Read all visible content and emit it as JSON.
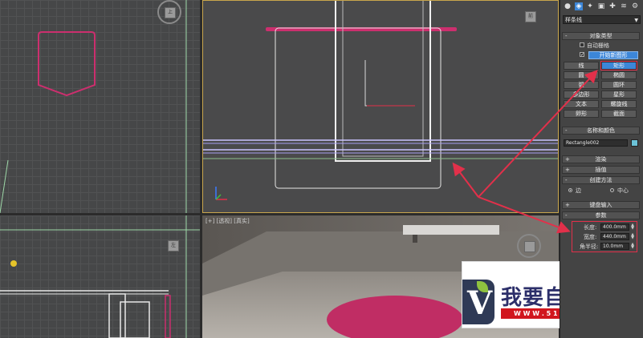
{
  "panel": {
    "dropdown_value": "样条线",
    "object_type": {
      "title": "对象类型",
      "autogrid_label": "自动栅格",
      "start_new_shape_label": "开始新图形",
      "buttons": [
        "线",
        "矩形",
        "圆",
        "椭圆",
        "弧",
        "圆环",
        "多边形",
        "星形",
        "文本",
        "螺旋线",
        "卵形",
        "截面"
      ]
    },
    "name_color": {
      "title": "名称和颜色",
      "name_value": "Rectangle002",
      "swatch_color": "#6cc3d8"
    },
    "render_title": "渲染",
    "interp_title": "插值",
    "creation_method": {
      "title": "创建方法",
      "option_edge": "边",
      "option_center": "中心"
    },
    "keyboard_title": "键盘输入",
    "params": {
      "title": "参数",
      "length_label": "长度:",
      "length_value": "400.0mm",
      "width_label": "宽度:",
      "width_value": "440.0mm",
      "corner_label": "角半径:",
      "corner_value": "10.0mm"
    }
  },
  "viewports": {
    "bottom_right_label": "[+] [透视] [真实]"
  },
  "watermark": {
    "logo_letter": "V",
    "title": "我要自學網",
    "url": "W W W . 5 1 z x w . N E T"
  },
  "colors": {
    "highlight_red": "#e2304a",
    "selection_blue": "#3c86d8",
    "shape_pink": "#cc2f6e"
  }
}
